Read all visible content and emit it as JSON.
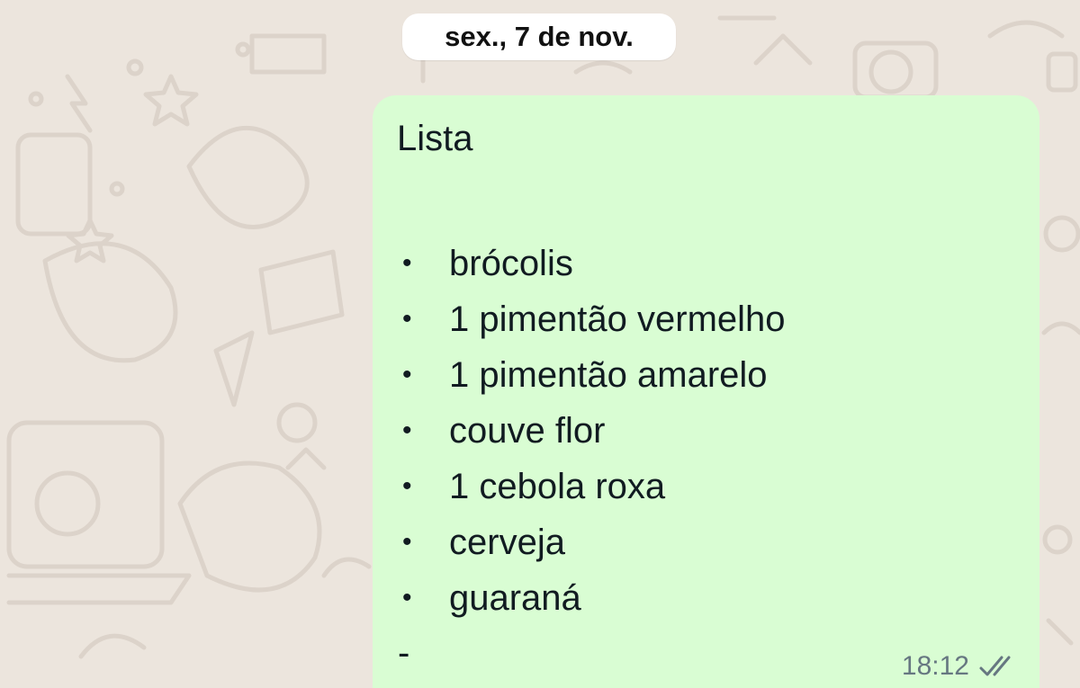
{
  "date_separator": "sex., 7 de nov.",
  "message": {
    "title": "Lista",
    "items": [
      "brócolis",
      "1 pimentão vermelho",
      "1 pimentão amarelo",
      "couve flor",
      "1 cebola roxa",
      "cerveja",
      "guaraná"
    ],
    "bullet": "•",
    "trailing": "-",
    "time": "18:12",
    "status_icon": "double-check-icon"
  },
  "colors": {
    "background": "#ece5dd",
    "bubble": "#d9fdd3",
    "meta_text": "#667781"
  }
}
